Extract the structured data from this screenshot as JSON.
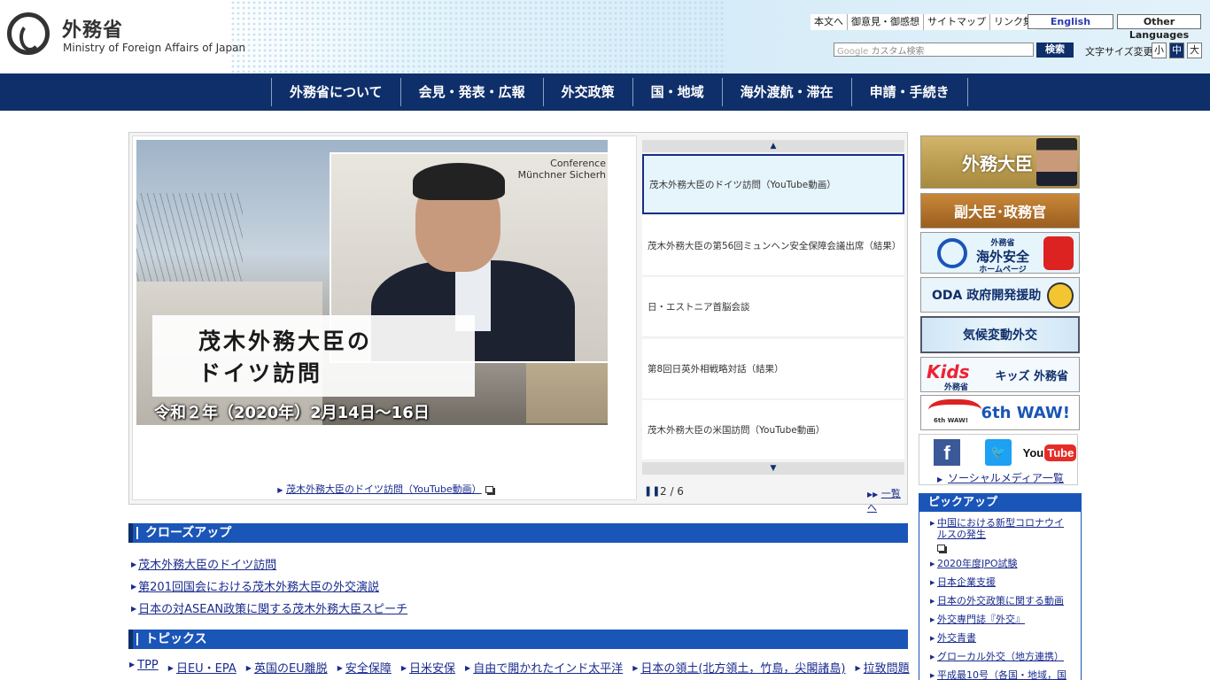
{
  "header": {
    "logo_ja": "外務省",
    "logo_en": "Ministry of Foreign Affairs of Japan",
    "util_links": [
      "本文へ",
      "御意見・御感想",
      "サイトマップ",
      "リンク集"
    ],
    "lang_english": "English",
    "lang_other": "Other Languages",
    "search_placeholder": "カスタム検索",
    "search_brand": "Google",
    "search_button": "検索",
    "font_size_label": "文字サイズ変更",
    "font_size_small": "小",
    "font_size_medium": "中",
    "font_size_large": "大"
  },
  "nav": [
    "外務省について",
    "会見・発表・広報",
    "外交政策",
    "国・地域",
    "海外渡航・滞在",
    "申請・手続き"
  ],
  "carousel": {
    "slide_title_line1": "茂木外務大臣の",
    "slide_title_line2": "ドイツ訪問",
    "slide_date": "令和２年（2020年）2月14日～16日",
    "slide_conf_text_1": "Conference",
    "slide_conf_text_2": "Münchner Sicherh",
    "slide_link": "茂木外務大臣のドイツ訪問（YouTube動画）",
    "items": [
      "茂木外務大臣のドイツ訪問（YouTube動画）",
      "茂木外務大臣の第56回ミュンヘン安全保障会議出席（結果）",
      "日・エストニア首脳会談",
      "第8回日英外相戦略対話（結果）",
      "茂木外務大臣の米国訪問（YouTube動画）"
    ],
    "active_index": 0,
    "counter": "2 / 6",
    "list_link": "一覧へ"
  },
  "closeup": {
    "heading": "クローズアップ",
    "items": [
      "茂木外務大臣のドイツ訪問",
      "第201回国会における茂木外務大臣の外交演説",
      "日本の対ASEAN政策に関する茂木外務大臣スピーチ"
    ]
  },
  "topics": {
    "heading": "トピックス",
    "items": [
      "TPP",
      "日EU・EPA",
      "英国のEU離脱",
      "安全保障",
      "日米安保",
      "自由で開かれたインド太平洋",
      "日本の領土(北方領土，竹島，尖閣諸島)",
      "拉致問題"
    ]
  },
  "banners": {
    "minister": "外務大臣",
    "vice": "副大臣･政務官",
    "safety_1": "外務省",
    "safety_2": "海外安全",
    "safety_3": "ホームページ",
    "oda": "ODA 政府開発援助",
    "climate": "気候変動外交",
    "kids_logo": "Kids",
    "kids_sub": "外務省",
    "kids": "キッズ 外務省",
    "waw": "6th WAW!"
  },
  "social": {
    "facebook": "f",
    "youtube_a": "You",
    "youtube_b": "Tube",
    "link": "ソーシャルメディア一覧"
  },
  "pickup": {
    "heading": "ピックアップ",
    "items": [
      "中国における新型コロナウイルスの発生",
      "2020年度JPO試験",
      "日本企業支援",
      "日本の外交政策に関する動画",
      "外交専門誌『外交』",
      "外交青書",
      "グローカル外交（地方連携）",
      "平成最10号（各国・地域，国"
    ]
  },
  "colors": {
    "nav_bg": "#0f2f6a",
    "section_head": "#1a55b8",
    "link": "#1a2b8c"
  }
}
